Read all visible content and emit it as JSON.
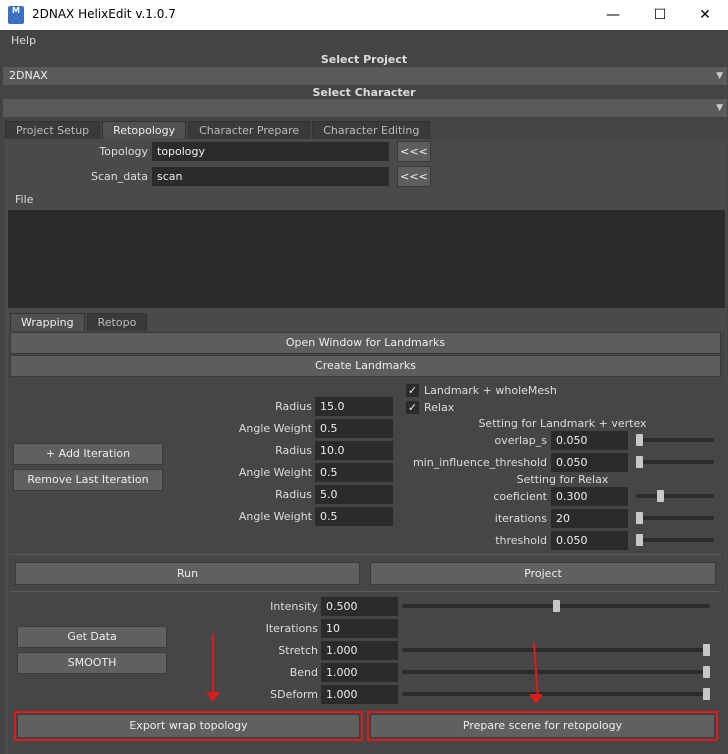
{
  "window": {
    "title": "2DNAX HelixEdit v.1.0.7",
    "icon_label": "M",
    "minimize": "—",
    "maximize": "☐",
    "close": "✕"
  },
  "menu": {
    "help": "Help"
  },
  "project": {
    "label": "Select Project",
    "value": "2DNAX"
  },
  "character": {
    "label": "Select Character",
    "value": ""
  },
  "tabs": [
    "Project Setup",
    "Retopology",
    "Character Prepare",
    "Character Editing"
  ],
  "retopo": {
    "topology_label": "Topology",
    "topology_value": "topology",
    "scan_label": "Scan_data",
    "scan_value": "scan",
    "load_button": "<<<",
    "file_label": "File"
  },
  "subtabs": [
    "Wrapping",
    "Retopo"
  ],
  "wrapping": {
    "open_landmarks": "Open Window for Landmarks",
    "create_landmarks": "Create Landmarks",
    "add_iteration": "+ Add Iteration",
    "remove_iteration": "Remove Last Iteration",
    "iterations": [
      {
        "radius_label": "Radius",
        "radius": "15.0",
        "angle_label": "Angle Weight",
        "angle": "0.5"
      },
      {
        "radius_label": "Radius",
        "radius": "10.0",
        "angle_label": "Angle Weight",
        "angle": "0.5"
      },
      {
        "radius_label": "Radius",
        "radius": "5.0",
        "angle_label": "Angle Weight",
        "angle": "0.5"
      }
    ],
    "landmark_whole_mesh": "Landmark + wholeMesh",
    "relax": "Relax",
    "setting_landmark_vertex": "Setting for Landmark + vertex",
    "overlap_label": "overlap_s",
    "overlap_value": "0.050",
    "min_influence_label": "min_influence_threshold",
    "min_influence_value": "0.050",
    "setting_relax": "Setting for Relax",
    "coef_label": "coeficient",
    "coef_value": "0.300",
    "iter_label": "iterations",
    "iter_value": "20",
    "threshold_label": "threshold",
    "threshold_value": "0.050",
    "run": "Run",
    "project": "Project",
    "get_data": "Get Data",
    "smooth": "SMOOTH",
    "intensity_label": "Intensity",
    "intensity_value": "0.500",
    "iterations2_label": "Iterations",
    "iterations2_value": "10",
    "stretch_label": "Stretch",
    "stretch_value": "1.000",
    "bend_label": "Bend",
    "bend_value": "1.000",
    "sdeform_label": "SDeform",
    "sdeform_value": "1.000",
    "export_wrap": "Export wrap topology",
    "prepare_scene": "Prepare scene for retopology"
  },
  "sliders": {
    "overlap": 0.0,
    "min_influence": 0.0,
    "coef": 0.3,
    "iter": 0.0,
    "threshold": 0.0,
    "intensity": 0.5,
    "stretch": 1.0,
    "bend": 1.0,
    "sdeform": 1.0
  },
  "colors": {
    "annotation_red": "#e0191a",
    "background": "#444444"
  }
}
